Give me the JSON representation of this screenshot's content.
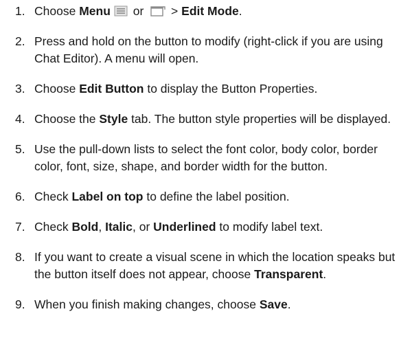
{
  "steps": [
    {
      "number": "1.",
      "parts": {
        "a": "Choose ",
        "b": "Menu",
        "c": " or ",
        "d": " > ",
        "e": "Edit Mode",
        "f": "."
      },
      "icons": [
        "menu-icon",
        "window-icon"
      ]
    },
    {
      "number": "2.",
      "text": "Press and hold on the button to modify (right-click if you are using Chat Editor). A menu will open."
    },
    {
      "number": "3.",
      "parts": {
        "a": "Choose ",
        "b": "Edit Button",
        "c": " to display the Button Properties."
      }
    },
    {
      "number": "4.",
      "parts": {
        "a": "Choose the ",
        "b": "Style",
        "c": " tab. The button style properties will be displayed."
      }
    },
    {
      "number": "5.",
      "text": "Use the pull-down lists to select the font color, body color, border color, font, size, shape, and border width for the button."
    },
    {
      "number": "6.",
      "parts": {
        "a": "Check ",
        "b": "Label on top",
        "c": " to define the label position."
      }
    },
    {
      "number": "7.",
      "parts": {
        "a": "Check ",
        "b": "Bold",
        "c": ", ",
        "d": "Italic",
        "e": ", or ",
        "f": "Underlined",
        "g": " to modify label text."
      }
    },
    {
      "number": "8.",
      "parts": {
        "a": "If you want to create a visual scene in which the location speaks but the button itself does not appear, choose ",
        "b": "Transparent",
        "c": "."
      }
    },
    {
      "number": "9.",
      "parts": {
        "a": "When you finish making changes, choose ",
        "b": "Save",
        "c": "."
      }
    }
  ]
}
